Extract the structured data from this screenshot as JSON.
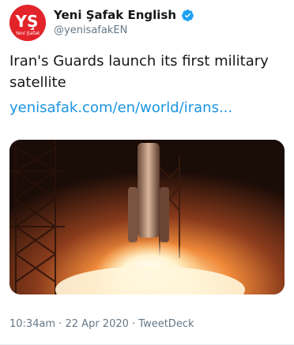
{
  "author": {
    "display_name": "Yeni Şafak English",
    "handle": "@yenisafakEN",
    "verified": true,
    "avatar_logo": "YŞ",
    "avatar_subtext": "Yeni Şafak",
    "avatar_color": "#e3232a"
  },
  "tweet": {
    "text_line1": "Iran's Guards launch its first military",
    "text_line2": "satellite",
    "link": "yenisafak.com/en/world/irans...",
    "link_color": "#1b95e0"
  },
  "media": {
    "icon": "rocket-launch-photo"
  },
  "meta": {
    "time": "10:34am",
    "separator": " · ",
    "date": "22 Apr 2020",
    "source": "TweetDeck"
  }
}
